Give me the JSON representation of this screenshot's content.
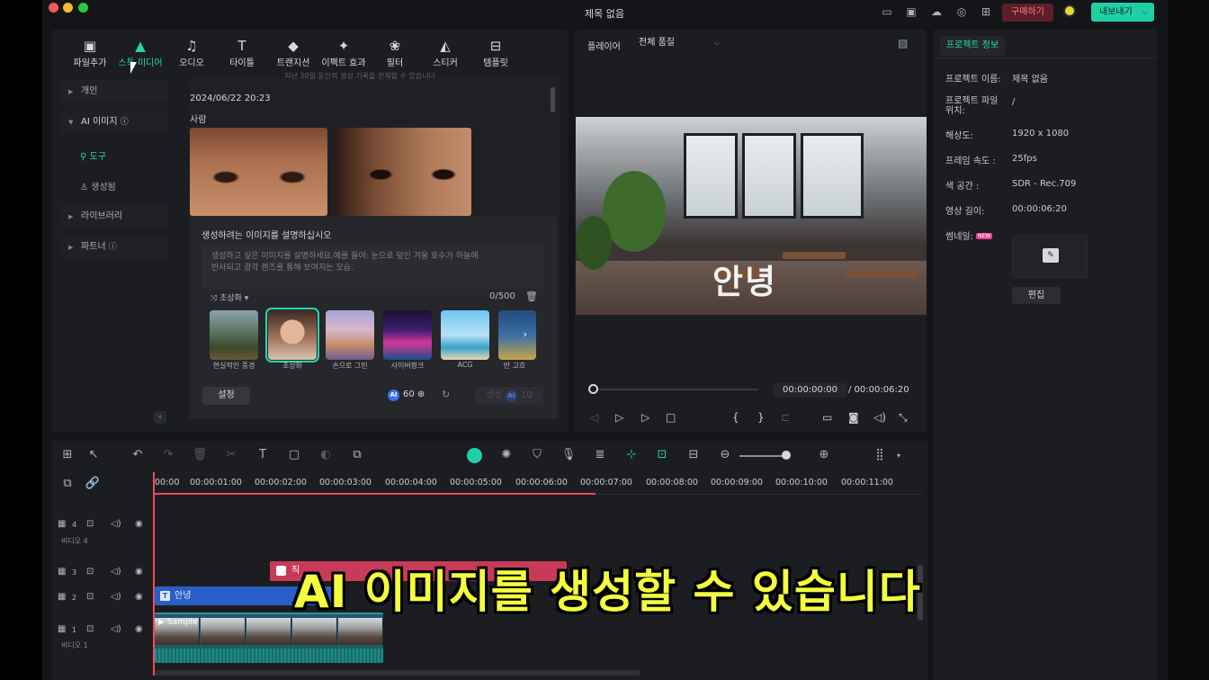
{
  "window": {
    "title": "제목 없음"
  },
  "header": {
    "buy_label": "구매하기",
    "export_label": "내보내기"
  },
  "toolbar_tabs": [
    {
      "label": "파일추가",
      "icon": "import-icon"
    },
    {
      "label": "스톡 미디어",
      "icon": "stock-media-icon"
    },
    {
      "label": "오디오",
      "icon": "music-note-icon"
    },
    {
      "label": "타이틀",
      "icon": "text-t-icon"
    },
    {
      "label": "트랜지션",
      "icon": "transition-icon"
    },
    {
      "label": "이펙트 효과",
      "icon": "effects-sparkle-icon"
    },
    {
      "label": "필터",
      "icon": "filter-icon"
    },
    {
      "label": "스티커",
      "icon": "sticker-icon"
    },
    {
      "label": "템플릿",
      "icon": "template-icon"
    }
  ],
  "sidebar": {
    "items": [
      {
        "label": "개인"
      },
      {
        "label": "AI 이미지"
      },
      {
        "label": "라이브러리"
      },
      {
        "label": "파트너"
      }
    ],
    "sub_items": [
      {
        "label": "도구"
      },
      {
        "label": "생성됨"
      }
    ]
  },
  "library": {
    "note": "지난 30일 동안의 생성 기록을 전체할 수 있습니다",
    "date": "2024/06/22 20:23",
    "group_label": "사람"
  },
  "generator": {
    "title": "생성하려는 이미지를 설명하십시오",
    "placeholder_line1": "생성하고 싶은 이미지를 설명하세요.예를 들어: 눈으로 덮인 겨울 호수가 하늘에",
    "placeholder_line2": "반사되고 광각 렌즈를 통해 보여지는 모습.",
    "style_label": "초상화",
    "count": "0/500",
    "styles": [
      {
        "label": "현실적인 풍경"
      },
      {
        "label": "초상화"
      },
      {
        "label": "손으로 그린"
      },
      {
        "label": "사이버펑크"
      },
      {
        "label": "ACG"
      },
      {
        "label": "반 고흐"
      }
    ],
    "settings_label": "설정",
    "credits": "60",
    "generate_label": "생성",
    "generate_cost": "10"
  },
  "player": {
    "label": "플레이어",
    "quality": "전체 품질",
    "overlay_text": "안녕",
    "current_time": "00:00:00:00",
    "total_time": "/ 00:00:06:20"
  },
  "project_info": {
    "tab_label": "프로젝트 정보",
    "fields": [
      {
        "label": "프로젝트 이름:",
        "value": "제목 없음"
      },
      {
        "label": "프로젝트 파일",
        "value": "/"
      },
      {
        "label": "해상도:",
        "value": "1920 x 1080"
      },
      {
        "label": "프레임 속도 :",
        "value": "25fps"
      },
      {
        "label": "색 공간 :",
        "value": "SDR - Rec.709"
      },
      {
        "label": "영상 길이:",
        "value": "00:00:06:20"
      }
    ],
    "file_label_line2": "위치:",
    "thumbnail_label": "썸네일:",
    "new_badge": "NEW",
    "edit_label": "편집"
  },
  "timeline": {
    "ruler": [
      "00:00",
      "00:00:01:00",
      "00:00:02:00",
      "00:00:03:00",
      "00:00:04:00",
      "00:00:05:00",
      "00:00:06:00",
      "00:00:07:00",
      "00:00:08:00",
      "00:00:09:00",
      "00:00:10:00",
      "00:00:11:00"
    ],
    "tracks": [
      {
        "num": "4",
        "name": "비디오 4"
      },
      {
        "num": "3",
        "name": ""
      },
      {
        "num": "2",
        "name": ""
      },
      {
        "num": "1",
        "name": "비디오 1"
      }
    ],
    "title_clip": "안녕",
    "sticker_clip": "직",
    "video_clip": "Sample"
  },
  "caption": "AI 이미지를 생성할 수 있습니다",
  "colors": {
    "accent": "#27d7b0",
    "playhead": "#f04a5b",
    "caption": "#f3ff3d",
    "buy": "#5c1f29"
  }
}
